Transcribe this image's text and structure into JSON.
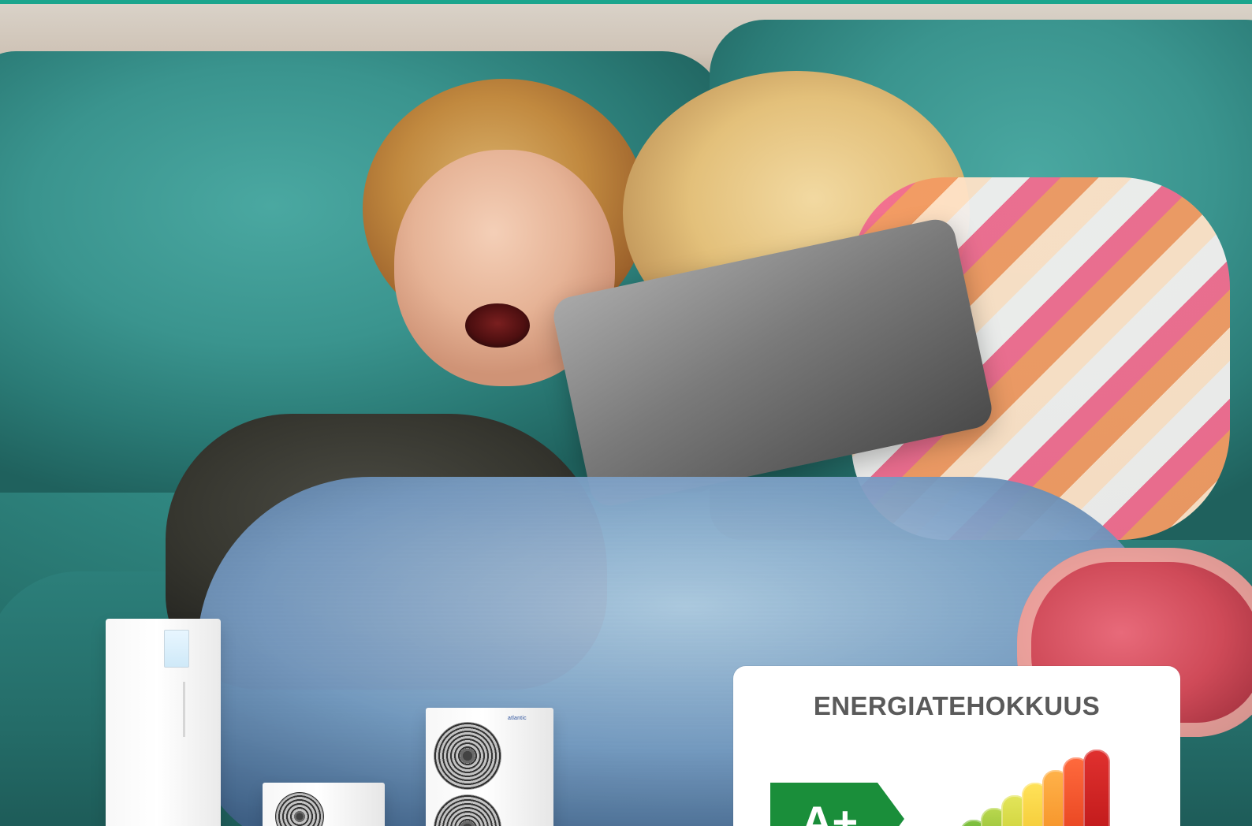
{
  "header": {
    "accent_color": "#1aa58d"
  },
  "energy_label": {
    "title": "ENERGIATEHOKKUUS",
    "class_text": "A+",
    "colors": {
      "arrow": "#1a8e3a",
      "title": "#5a5a5a"
    }
  },
  "products": {
    "brand": "atlantic"
  }
}
